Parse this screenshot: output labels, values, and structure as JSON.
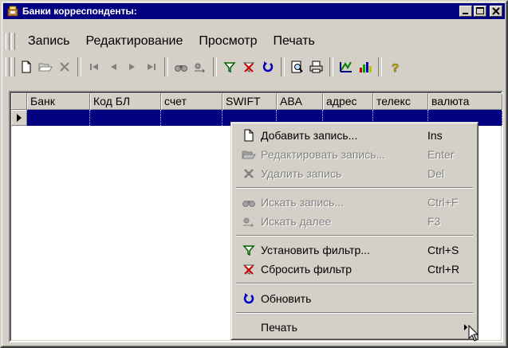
{
  "window": {
    "title": "Банки корреспонденты:"
  },
  "menubar": {
    "items": [
      "Запись",
      "Редактирование",
      "Просмотр",
      "Печать"
    ]
  },
  "grid": {
    "columns": [
      "Банк",
      "Код БЛ",
      "счет",
      "SWIFT",
      "ABA",
      "адрес",
      "телекс",
      "валюта"
    ]
  },
  "context_menu": {
    "items": [
      {
        "label": "Добавить запись...",
        "shortcut": "Ins"
      },
      {
        "label": "Редактировать запись...",
        "shortcut": "Enter"
      },
      {
        "label": "Удалить запись",
        "shortcut": "Del"
      },
      {
        "label": "Искать запись...",
        "shortcut": "Ctrl+F"
      },
      {
        "label": "Искать далее",
        "shortcut": "F3"
      },
      {
        "label": "Установить фильтр...",
        "shortcut": "Ctrl+S"
      },
      {
        "label": "Сбросить фильтр",
        "shortcut": "Ctrl+R"
      },
      {
        "label": "Обновить",
        "shortcut": ""
      },
      {
        "label": "Печать",
        "shortcut": ""
      }
    ]
  },
  "colors": {
    "titlebar": "#000080",
    "selection": "#000080",
    "face": "#d4d0c8"
  }
}
